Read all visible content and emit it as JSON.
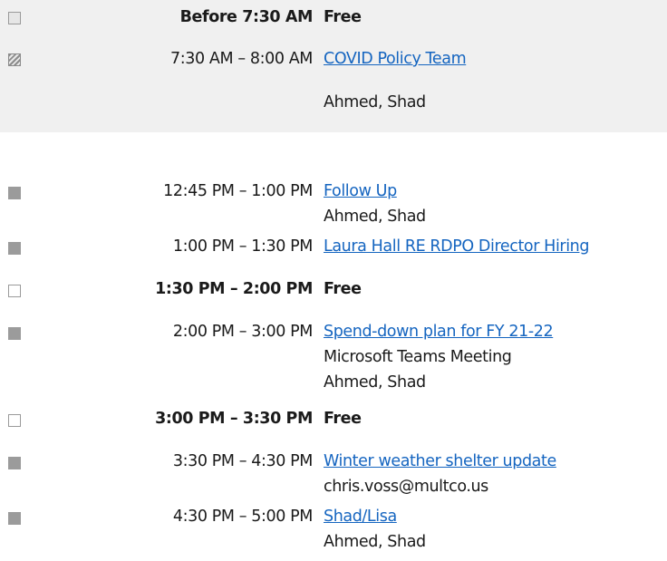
{
  "schedule": {
    "rows": [
      {
        "time": "Before 7:30 AM",
        "status": "free",
        "title": "Free",
        "details": []
      },
      {
        "time": "7:30 AM – 8:00 AM",
        "status": "tentative",
        "title": "COVID Policy Team",
        "details": [
          "Ahmed, Shad"
        ]
      },
      {
        "time": "12:45 PM – 1:00 PM",
        "status": "busy",
        "title": "Follow Up",
        "details": [
          "Ahmed, Shad"
        ]
      },
      {
        "time": "1:00 PM – 1:30 PM",
        "status": "busy",
        "title": "Laura Hall RE RDPO Director Hiring",
        "details": []
      },
      {
        "time": "1:30 PM – 2:00 PM",
        "status": "free",
        "title": "Free",
        "details": []
      },
      {
        "time": "2:00 PM – 3:00 PM",
        "status": "busy",
        "title": "Spend-down plan for FY 21-22",
        "details": [
          "Microsoft Teams Meeting",
          "Ahmed, Shad"
        ]
      },
      {
        "time": "3:00 PM – 3:30 PM",
        "status": "free",
        "title": "Free",
        "details": []
      },
      {
        "time": "3:30 PM – 4:30 PM",
        "status": "busy",
        "title": "Winter weather shelter update",
        "details": [
          "chris.voss@multco.us"
        ]
      },
      {
        "time": "4:30 PM – 5:00 PM",
        "status": "busy",
        "title": "Shad/Lisa",
        "details": [
          "Ahmed, Shad"
        ]
      }
    ]
  },
  "colors": {
    "link": "#1565c0",
    "busy": "#9b9b9b",
    "shaded_background": "#f0f0f0"
  }
}
